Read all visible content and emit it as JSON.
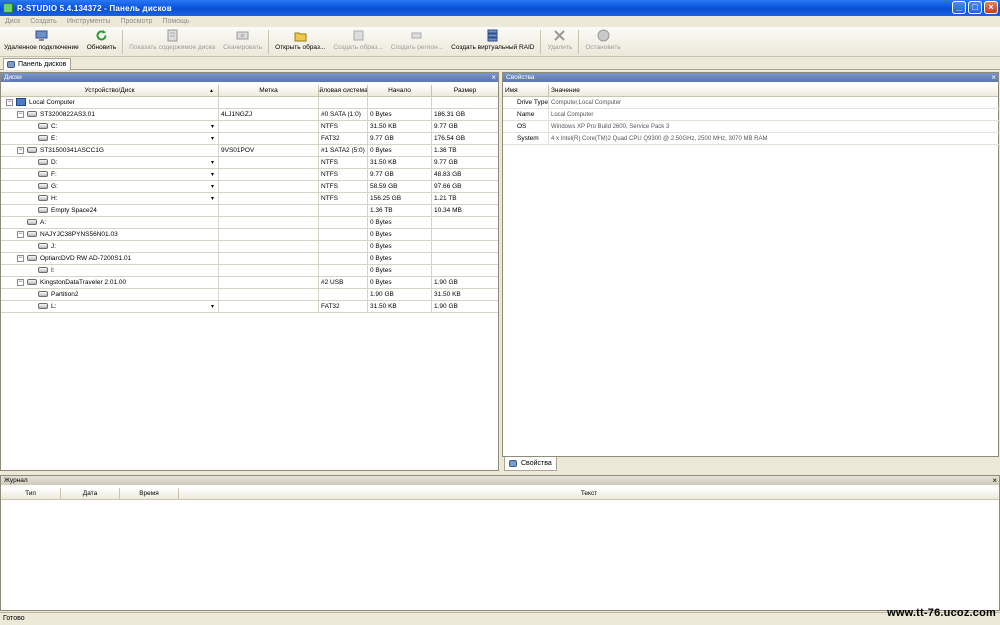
{
  "window": {
    "title": "R-STUDIO 5.4.134372 - Панель дисков"
  },
  "menu": [
    "Диск",
    "Создать",
    "Инструменты",
    "Просмотр",
    "Помощь"
  ],
  "toolbar": [
    {
      "label": "Удаленное подключение",
      "icon": "remote-connect-icon",
      "enabled": true
    },
    {
      "label": "Обновить",
      "icon": "refresh-icon",
      "enabled": true
    },
    {
      "label": "Показать содержимое диска",
      "icon": "show-contents-icon",
      "enabled": false
    },
    {
      "label": "Сканировать",
      "icon": "scan-icon",
      "enabled": false
    },
    {
      "label": "Открыть образ...",
      "icon": "open-image-icon",
      "enabled": true
    },
    {
      "label": "Создать образ...",
      "icon": "create-image-icon",
      "enabled": false
    },
    {
      "label": "Создать регион...",
      "icon": "create-region-icon",
      "enabled": false
    },
    {
      "label": "Создать виртуальный RAID",
      "icon": "virtual-raid-icon",
      "enabled": true
    },
    {
      "label": "Удалить",
      "icon": "delete-icon",
      "enabled": false
    },
    {
      "label": "Остановить",
      "icon": "stop-icon",
      "enabled": false
    }
  ],
  "tab": {
    "label": "Панель дисков"
  },
  "disks_panel": {
    "title": "Диски",
    "columns": {
      "device": "Устройство/Диск",
      "label": "Метка",
      "fs": "Файловая система",
      "start": "Начало",
      "size": "Размер"
    },
    "rows": [
      {
        "device": "Local Computer",
        "label": "",
        "fs": "",
        "start": "",
        "size": "",
        "level": 0,
        "icon": "computer",
        "toggle": "−",
        "dd": false
      },
      {
        "device": "ST3200822AS3.01",
        "label": "4LJ1NGZJ",
        "fs": "#0 SATA (1:0)",
        "start": "0 Bytes",
        "size": "186.31 GB",
        "level": 1,
        "icon": "disk",
        "toggle": "−",
        "dd": false
      },
      {
        "device": "C:",
        "label": "",
        "fs": "NTFS",
        "start": "31.50 KB",
        "size": "9.77 GB",
        "level": 2,
        "icon": "disk",
        "toggle": "",
        "dd": true
      },
      {
        "device": "E:",
        "label": "",
        "fs": "FAT32",
        "start": "9.77 GB",
        "size": "176.54 GB",
        "level": 2,
        "icon": "disk",
        "toggle": "",
        "dd": true
      },
      {
        "device": "ST31500341ASCC1G",
        "label": "9VS01POV",
        "fs": "#1 SATA2 (5:0)",
        "start": "0 Bytes",
        "size": "1.36 TB",
        "level": 1,
        "icon": "disk",
        "toggle": "−",
        "dd": false
      },
      {
        "device": "D:",
        "label": "",
        "fs": "NTFS",
        "start": "31.50 KB",
        "size": "9.77 GB",
        "level": 2,
        "icon": "disk",
        "toggle": "",
        "dd": true
      },
      {
        "device": "F:",
        "label": "",
        "fs": "NTFS",
        "start": "9.77 GB",
        "size": "48.83 GB",
        "level": 2,
        "icon": "disk",
        "toggle": "",
        "dd": true
      },
      {
        "device": "G:",
        "label": "",
        "fs": "NTFS",
        "start": "58.59 GB",
        "size": "97.66 GB",
        "level": 2,
        "icon": "disk",
        "toggle": "",
        "dd": true
      },
      {
        "device": "H:",
        "label": "",
        "fs": "NTFS",
        "start": "156.25 GB",
        "size": "1.21 TB",
        "level": 2,
        "icon": "disk",
        "toggle": "",
        "dd": true
      },
      {
        "device": "Empty Space24",
        "label": "",
        "fs": "",
        "start": "1.36 TB",
        "size": "10.34 MB",
        "level": 2,
        "icon": "disk",
        "toggle": "",
        "dd": false
      },
      {
        "device": "A:",
        "label": "",
        "fs": "",
        "start": "0 Bytes",
        "size": "",
        "level": 1,
        "icon": "disk",
        "toggle": "",
        "dd": false
      },
      {
        "device": "NAJYJC38PYNS56N01.03",
        "label": "",
        "fs": "",
        "start": "0 Bytes",
        "size": "",
        "level": 1,
        "icon": "disk",
        "toggle": "−",
        "dd": false
      },
      {
        "device": "J:",
        "label": "",
        "fs": "",
        "start": "0 Bytes",
        "size": "",
        "level": 2,
        "icon": "disk",
        "toggle": "",
        "dd": false
      },
      {
        "device": "OptiarcDVD RW AD-7200S1.01",
        "label": "",
        "fs": "",
        "start": "0 Bytes",
        "size": "",
        "level": 1,
        "icon": "disk",
        "toggle": "−",
        "dd": false
      },
      {
        "device": "I:",
        "label": "",
        "fs": "",
        "start": "0 Bytes",
        "size": "",
        "level": 2,
        "icon": "disk",
        "toggle": "",
        "dd": false
      },
      {
        "device": "KingstonDataTraveler 2.01.00",
        "label": "",
        "fs": "#2 USB",
        "start": "0 Bytes",
        "size": "1.90 GB",
        "level": 1,
        "icon": "disk",
        "toggle": "−",
        "dd": false
      },
      {
        "device": "Partition2",
        "label": "",
        "fs": "",
        "start": "1.90 GB",
        "size": "31.50 KB",
        "level": 2,
        "icon": "disk",
        "toggle": "",
        "dd": false
      },
      {
        "device": "L:",
        "label": "",
        "fs": "FAT32",
        "start": "31.50 KB",
        "size": "1.90 GB",
        "level": 2,
        "icon": "disk",
        "toggle": "",
        "dd": true
      }
    ]
  },
  "properties_panel": {
    "title": "Свойства",
    "columns": {
      "name": "Имя",
      "value": "Значение"
    },
    "rows": [
      {
        "name": "Drive Type",
        "value": "Computer,Local Computer"
      },
      {
        "name": "Name",
        "value": "Local Computer"
      },
      {
        "name": "OS",
        "value": "Windows XP Pro Build 2600, Service Pack 3"
      },
      {
        "name": "System",
        "value": "4 x Intel(R) Core(TM)2 Quad CPU   Q9300 @ 2.50GHz, 2500 MHz, 3070 MB RAM"
      }
    ],
    "tab_label": "Свойства"
  },
  "log_panel": {
    "title": "Журнал",
    "columns": {
      "type": "Тип",
      "date": "Дата",
      "time": "Время",
      "text": "Текст"
    }
  },
  "status": {
    "text": "Готово"
  },
  "watermark": "www.tt-76.ucoz.com"
}
